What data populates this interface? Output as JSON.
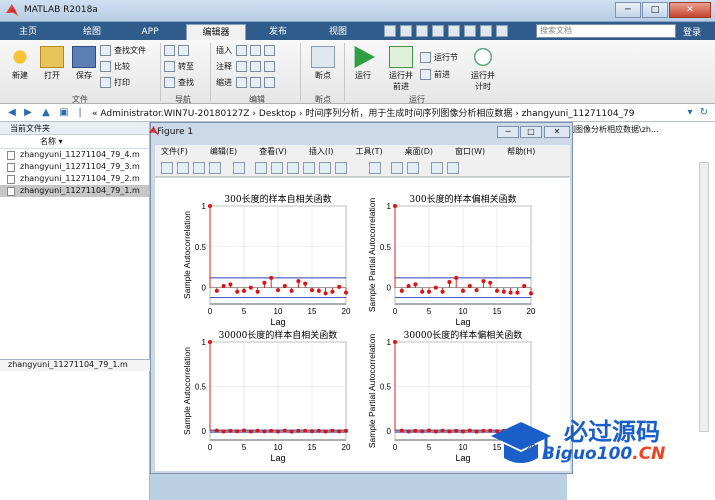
{
  "window": {
    "title": "MATLAB R2018a"
  },
  "tabs": [
    "主页",
    "绘图",
    "APP",
    "编辑器",
    "发布",
    "视图"
  ],
  "search_placeholder": "搜索文档",
  "login": "登录",
  "ribbon": {
    "new": "新建",
    "open": "打开",
    "save": "保存",
    "find_files": "查找文件",
    "compare": "比较",
    "print": "打印",
    "group_file": "文件",
    "goto": "转至",
    "find": "查找",
    "group_nav": "导航",
    "insert": "插入",
    "comment": "注释",
    "indent": "缩进",
    "group_edit": "编辑",
    "breakpoint": "断点",
    "group_bp": "断点",
    "run": "运行",
    "run_advance": "运行并\n前进",
    "run_section": "运行节",
    "advance": "前进",
    "run_time": "运行并\n计时",
    "group_run": "运行"
  },
  "address": {
    "path": "« Administrator.WIN7U-20180127Z › Desktop › 时间序列分析，用于生成时间序列图像分析相应数据 › zhangyuni_11271104_79"
  },
  "current_folder": {
    "header": "当前文件夹",
    "col_name": "名称 ▾",
    "files": [
      "zhangyuni_11271104_79_4.m",
      "zhangyuni_11271104_79_3.m",
      "zhangyuni_11271104_79_2.m",
      "zhangyuni_11271104_79_1.m"
    ],
    "selected_index": 3,
    "footer": "zhangyuni_11271104_79_1.m"
  },
  "right_panel": {
    "path": "列图像分析相应数据\\zh..."
  },
  "figure": {
    "title": "Figure 1",
    "menu": [
      "文件(F)",
      "编辑(E)",
      "查看(V)",
      "插入(I)",
      "工具(T)",
      "桌面(D)",
      "窗口(W)",
      "帮助(H)"
    ]
  },
  "chart_data": [
    {
      "type": "stem",
      "title": "300长度的样本自相关函数",
      "xlabel": "Lag",
      "ylabel": "Sample Autocorrelation",
      "xlim": [
        0,
        20
      ],
      "ylim": [
        -0.2,
        1
      ],
      "xticks": [
        "0",
        "5",
        "10",
        "15",
        "20"
      ],
      "yticks": [
        "0",
        "0.5",
        "1"
      ],
      "bound": 0.12,
      "x": [
        0,
        1,
        2,
        3,
        4,
        5,
        6,
        7,
        8,
        9,
        10,
        11,
        12,
        13,
        14,
        15,
        16,
        17,
        18,
        19,
        20
      ],
      "values": [
        1,
        -0.04,
        0.02,
        0.04,
        -0.05,
        -0.04,
        0.0,
        -0.05,
        0.06,
        0.12,
        -0.03,
        0.02,
        -0.04,
        0.08,
        0.05,
        -0.03,
        -0.04,
        -0.07,
        -0.05,
        0.01,
        -0.06
      ]
    },
    {
      "type": "stem",
      "title": "300长度的样本偏相关函数",
      "xlabel": "Lag",
      "ylabel": "Sample Partial Autocorrelation",
      "xlim": [
        0,
        20
      ],
      "ylim": [
        -0.2,
        1
      ],
      "xticks": [
        "0",
        "5",
        "10",
        "15",
        "20"
      ],
      "yticks": [
        "0",
        "0.5",
        "1"
      ],
      "bound": 0.12,
      "x": [
        0,
        1,
        2,
        3,
        4,
        5,
        6,
        7,
        8,
        9,
        10,
        11,
        12,
        13,
        14,
        15,
        16,
        17,
        18,
        19,
        20
      ],
      "values": [
        1,
        -0.04,
        0.02,
        0.04,
        -0.05,
        -0.05,
        0.0,
        -0.05,
        0.07,
        0.12,
        -0.04,
        0.02,
        -0.03,
        0.08,
        0.06,
        -0.04,
        -0.05,
        -0.06,
        -0.06,
        0.02,
        -0.07
      ]
    },
    {
      "type": "stem",
      "title": "30000长度的样本自相关函数",
      "xlabel": "Lag",
      "ylabel": "Sample Autocorrelation",
      "xlim": [
        0,
        20
      ],
      "ylim": [
        -0.1,
        1
      ],
      "xticks": [
        "0",
        "5",
        "10",
        "15",
        "20"
      ],
      "yticks": [
        "0",
        "0.5",
        "1"
      ],
      "bound": 0.012,
      "x": [
        0,
        1,
        2,
        3,
        4,
        5,
        6,
        7,
        8,
        9,
        10,
        11,
        12,
        13,
        14,
        15,
        16,
        17,
        18,
        19,
        20
      ],
      "values": [
        1,
        0.005,
        -0.004,
        0.003,
        -0.002,
        0.006,
        -0.005,
        0.004,
        -0.003,
        0.002,
        -0.004,
        0.005,
        -0.006,
        0.003,
        0.004,
        -0.002,
        0.003,
        -0.005,
        0.004,
        -0.003,
        0.002
      ]
    },
    {
      "type": "stem",
      "title": "30000长度的样本偏相关函数",
      "xlabel": "Lag",
      "ylabel": "Sample Partial Autocorrelation",
      "xlim": [
        0,
        20
      ],
      "ylim": [
        -0.1,
        1
      ],
      "xticks": [
        "0",
        "5",
        "10",
        "15",
        "20"
      ],
      "yticks": [
        "0",
        "0.5",
        "1"
      ],
      "bound": 0.012,
      "x": [
        0,
        1,
        2,
        3,
        4,
        5,
        6,
        7,
        8,
        9,
        10,
        11,
        12,
        13,
        14,
        15,
        16,
        17,
        18,
        19,
        20
      ],
      "values": [
        1,
        0.005,
        -0.004,
        0.003,
        -0.002,
        0.006,
        -0.005,
        0.004,
        -0.003,
        0.002,
        -0.004,
        0.005,
        -0.006,
        0.003,
        0.004,
        -0.002,
        0.003,
        -0.005,
        0.004,
        -0.003,
        0.002
      ]
    }
  ],
  "watermark": {
    "line1": "必过源码",
    "line2a": "Biguo100",
    "line2b": ".CN"
  }
}
